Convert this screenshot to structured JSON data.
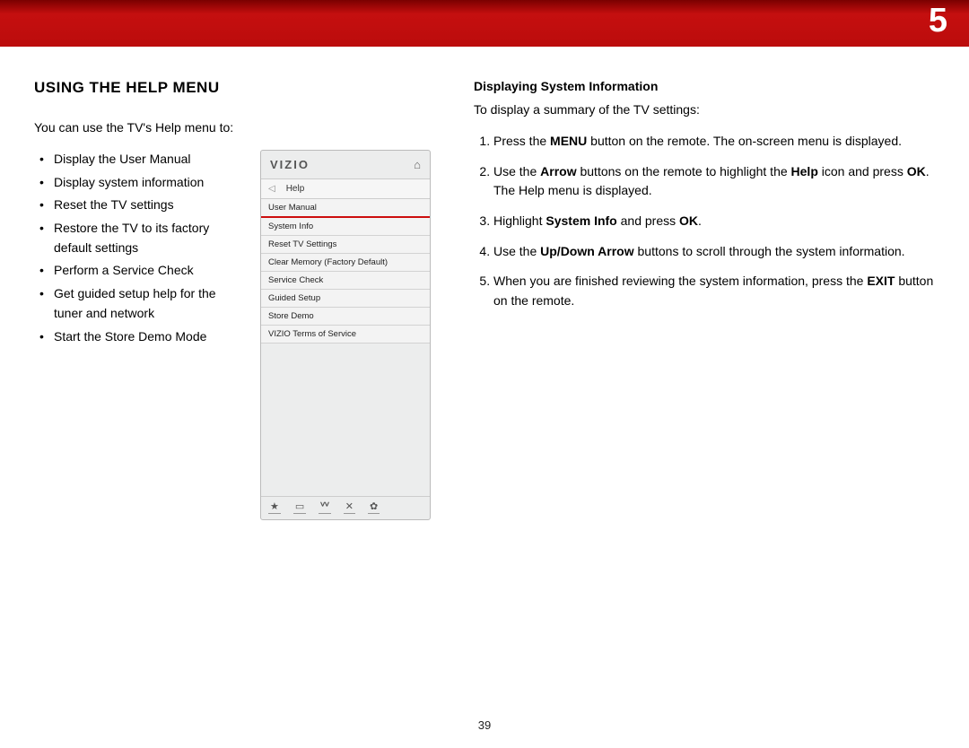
{
  "banner": {
    "chapter": "5"
  },
  "left": {
    "title": "Using the Help Menu",
    "intro": "You can use the TV's Help menu to:",
    "bullets": [
      "Display the User Manual",
      "Display system information",
      "Reset the TV settings",
      "Restore the TV to its factory default settings",
      "Perform a Service Check",
      "Get guided setup help for the tuner and network",
      "Start the Store Demo Mode"
    ]
  },
  "tvmenu": {
    "logo": "VIZIO",
    "title": "Help",
    "items": [
      "User Manual",
      "System Info",
      "Reset TV Settings",
      "Clear Memory (Factory Default)",
      "Service Check",
      "Guided Setup",
      "Store Demo",
      "VIZIO Terms of Service"
    ]
  },
  "right": {
    "subtitle": "Displaying System Information",
    "intro": "To display a summary of the TV settings:",
    "step1_a": "Press the ",
    "step1_b": "MENU",
    "step1_c": " button on the remote. The on-screen menu is displayed.",
    "step2_a": "Use the ",
    "step2_b": "Arrow",
    "step2_c": " buttons on the remote to highlight the ",
    "step2_d": "Help",
    "step2_e": " icon and press ",
    "step2_f": "OK",
    "step2_g": ". The Help menu is displayed.",
    "step3_a": "Highlight ",
    "step3_b": "System Info",
    "step3_c": " and press ",
    "step3_d": "OK",
    "step3_e": ".",
    "step4_a": "Use the ",
    "step4_b": "Up/Down Arrow",
    "step4_c": " buttons to scroll through the system information.",
    "step5_a": "When you are finished reviewing the system information, press the ",
    "step5_b": "EXIT",
    "step5_c": " button on the remote."
  },
  "pagenum": "39"
}
